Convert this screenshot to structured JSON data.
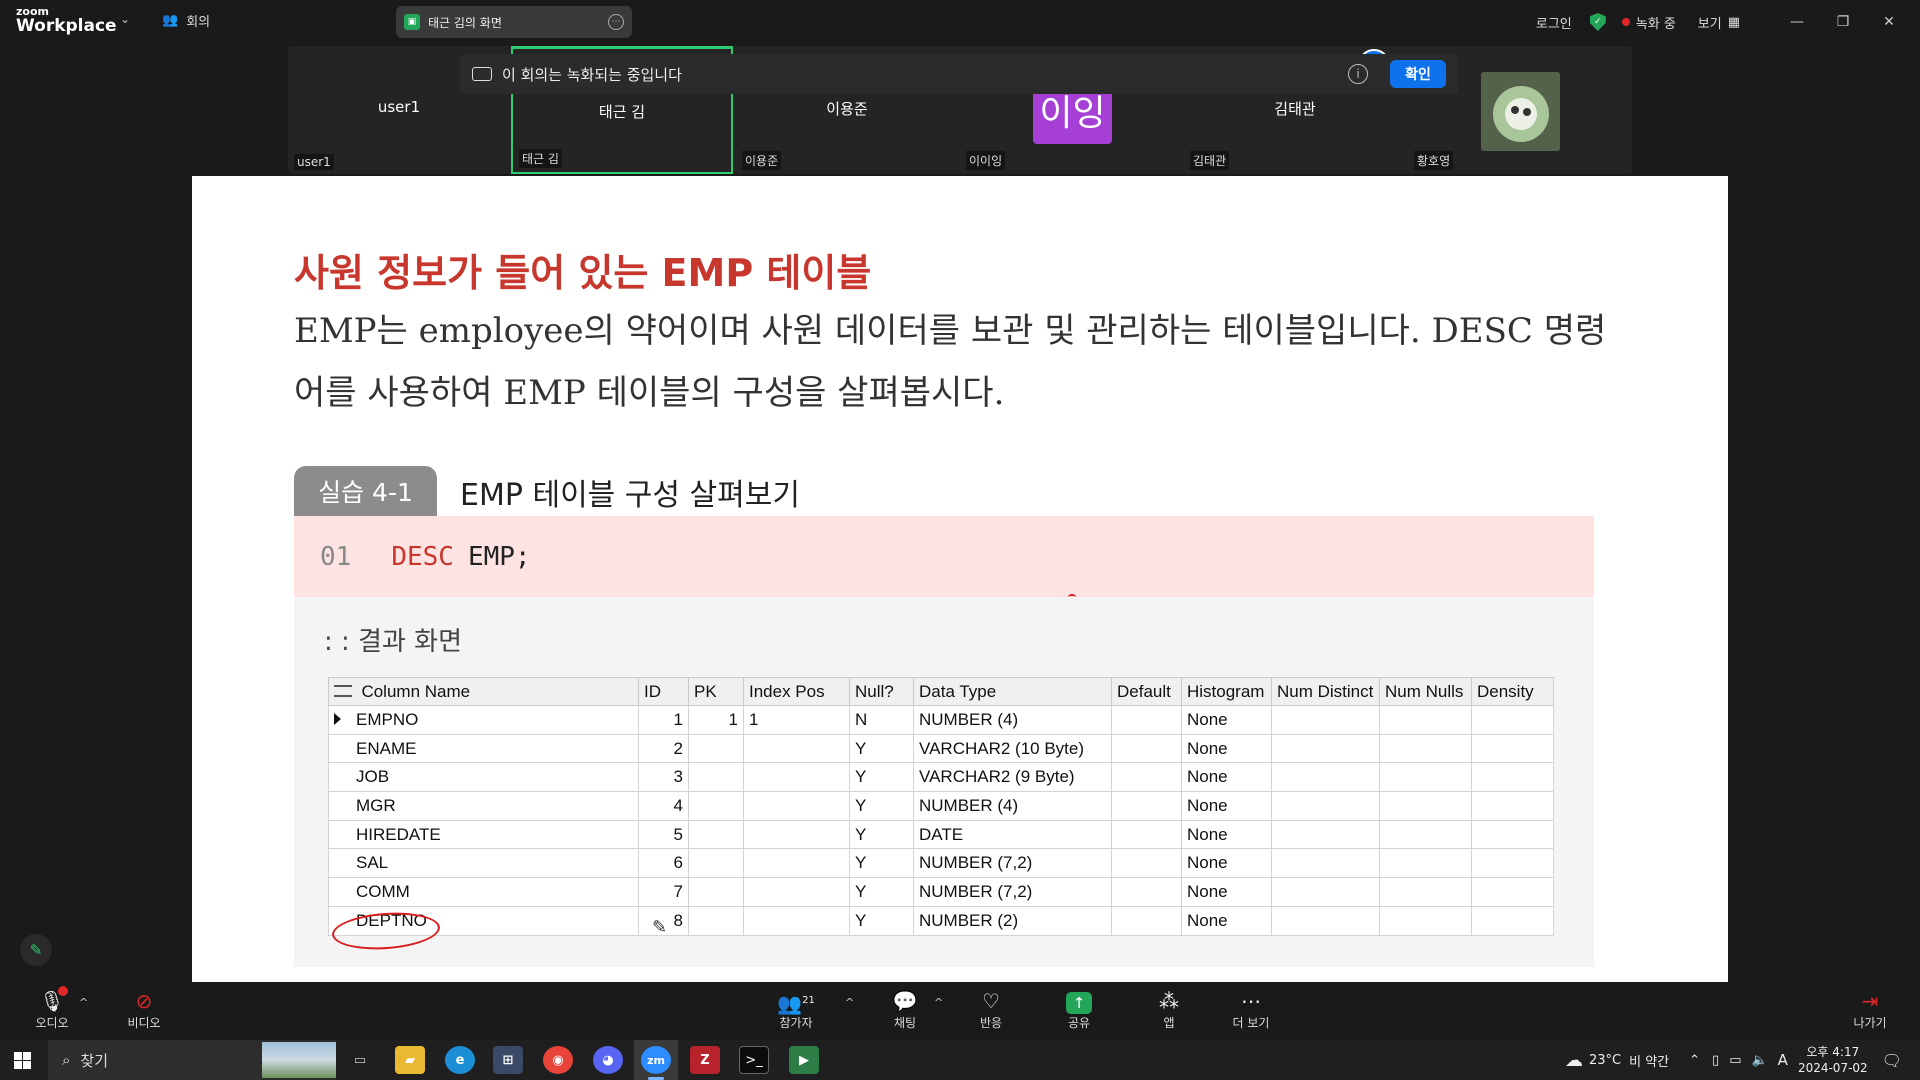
{
  "app": {
    "brand_small": "zoom",
    "brand_large": "Workplace",
    "meeting_label": "회의"
  },
  "share_tab": {
    "title": "태근 김의 화면"
  },
  "top_right": {
    "login": "로그인",
    "recording": "녹화 중",
    "view": "보기"
  },
  "recording_notice": {
    "text": "이 회의는 녹화되는 중입니다",
    "confirm": "확인"
  },
  "gallery": {
    "tiles": [
      {
        "center": "user1",
        "corner": "user1"
      },
      {
        "center": "태근 김",
        "corner": "태근 김"
      },
      {
        "center": "이용준",
        "corner": "이용준"
      },
      {
        "center": "이잉",
        "corner": "이이잉"
      },
      {
        "center": "김태관",
        "corner": "김태관"
      },
      {
        "center": "",
        "corner": "황호영"
      }
    ]
  },
  "slide": {
    "title": "사원 정보가 들어 있는 EMP 테이블",
    "body": "EMP는 employee의 약어이며 사원 데이터를 보관 및 관리하는 테이블입니다. DESC 명령어를 사용하여 EMP 테이블의 구성을 살펴봅시다.",
    "lab_tag": "실습 4-1",
    "lab_title": "EMP 테이블 구성 살펴보기",
    "code": {
      "line": "01",
      "keyword": "DESC",
      "rest": "EMP;"
    },
    "result_label": ": : 결과 화면",
    "table": {
      "headers": [
        "Column Name",
        "ID",
        "PK",
        "Index Pos",
        "Null?",
        "Data Type",
        "Default",
        "Histogram",
        "Num Distinct",
        "Num Nulls",
        "Density"
      ],
      "rows": [
        [
          "EMPNO",
          "1",
          "1",
          "1",
          "N",
          "NUMBER (4)",
          "",
          "None",
          "",
          "",
          ""
        ],
        [
          "ENAME",
          "2",
          "",
          "",
          "Y",
          "VARCHAR2 (10 Byte)",
          "",
          "None",
          "",
          "",
          ""
        ],
        [
          "JOB",
          "3",
          "",
          "",
          "Y",
          "VARCHAR2 (9 Byte)",
          "",
          "None",
          "",
          "",
          ""
        ],
        [
          "MGR",
          "4",
          "",
          "",
          "Y",
          "NUMBER (4)",
          "",
          "None",
          "",
          "",
          ""
        ],
        [
          "HIREDATE",
          "5",
          "",
          "",
          "Y",
          "DATE",
          "",
          "None",
          "",
          "",
          ""
        ],
        [
          "SAL",
          "6",
          "",
          "",
          "Y",
          "NUMBER (7,2)",
          "",
          "None",
          "",
          "",
          ""
        ],
        [
          "COMM",
          "7",
          "",
          "",
          "Y",
          "NUMBER (7,2)",
          "",
          "None",
          "",
          "",
          ""
        ],
        [
          "DEPTNO",
          "8",
          "",
          "",
          "Y",
          "NUMBER (2)",
          "",
          "None",
          "",
          "",
          ""
        ]
      ]
    }
  },
  "toolbar": {
    "audio": "오디오",
    "video": "비디오",
    "participants": "참가자",
    "participants_count": "21",
    "chat": "채팅",
    "reactions": "반응",
    "share": "공유",
    "apps": "앱",
    "more": "더 보기",
    "leave": "나가기"
  },
  "taskbar": {
    "search": "찾기",
    "weather": "23°C",
    "weather_desc": "비 약간",
    "ime": "A",
    "time": "오후 4:17",
    "date": "2024-07-02",
    "zoom_label": "zm"
  },
  "colors": {
    "accent_blue": "#0e72ed",
    "active_green": "#2ecc71",
    "title_red": "#c8372d",
    "avatar_purple": "#a53fd6"
  }
}
